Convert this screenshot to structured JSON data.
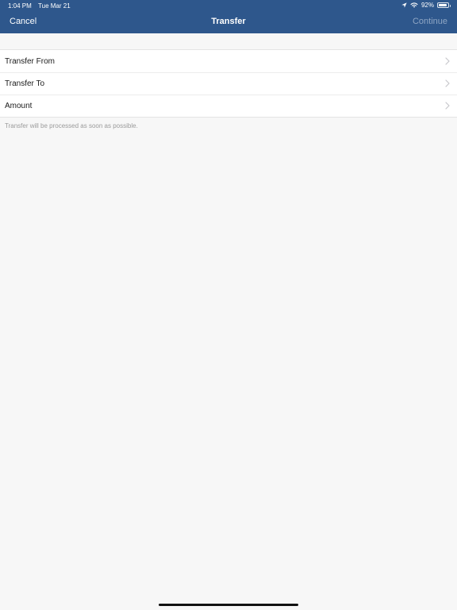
{
  "status_bar": {
    "time": "1:04 PM",
    "date": "Tue Mar 21",
    "battery_text": "92%",
    "battery_level": 0.92,
    "icons": [
      "location-arrow-icon",
      "wifi-icon",
      "battery-icon"
    ]
  },
  "nav": {
    "cancel_label": "Cancel",
    "title": "Transfer",
    "continue_label": "Continue"
  },
  "form": {
    "rows": [
      {
        "label": "Transfer From"
      },
      {
        "label": "Transfer To"
      },
      {
        "label": "Amount"
      }
    ],
    "footnote": "Transfer will be processed as soon as possible."
  },
  "colors": {
    "header_bg": "#2e578c",
    "page_bg": "#f7f7f7",
    "disabled_button": "#8fa6c4"
  }
}
